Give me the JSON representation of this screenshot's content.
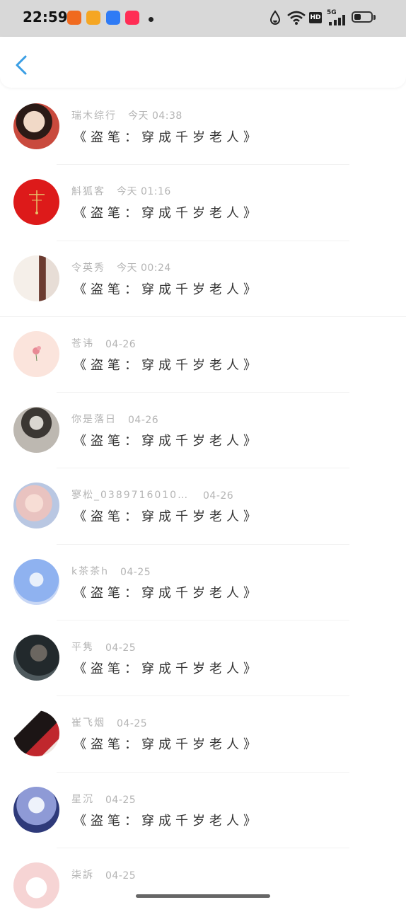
{
  "status_bar": {
    "time": "22:59",
    "hd": "HD",
    "network": "5G"
  },
  "header": {
    "back_icon": "chevron-left-icon"
  },
  "comments": [
    {
      "name": "瑞木综行",
      "time": "今天 04:38",
      "message": "《盗笔：穿成千岁老人》",
      "avatar_color": "#c94a3d"
    },
    {
      "name": "斛狐客",
      "time": "今天 01:16",
      "message": "《盗笔：穿成千岁老人》",
      "avatar_color": "#dd1a1a"
    },
    {
      "name": "令英秀",
      "time": "今天 00:24",
      "message": "《盗笔：穿成千岁老人》",
      "avatar_color": "#c9b7b0"
    },
    {
      "name": "苍讳",
      "time": "04-26",
      "message": "《盗笔：穿成千岁老人》",
      "avatar_color": "#fbe4dc"
    },
    {
      "name": "你是落日",
      "time": "04-26",
      "message": "《盗笔：穿成千岁老人》",
      "avatar_color": "#8a8680"
    },
    {
      "name": "寥松_038971601044​3…",
      "time": "04-26",
      "message": "《盗笔：穿成千岁老人》",
      "avatar_color": "#e9c3c0"
    },
    {
      "name": "k茶茶h",
      "time": "04-25",
      "message": "《盗笔：穿成千岁老人》",
      "avatar_color": "#8fb2f0"
    },
    {
      "name": "平隽",
      "time": "04-25",
      "message": "《盗笔：穿成千岁老人》",
      "avatar_color": "#3d4347"
    },
    {
      "name": "崔飞烟",
      "time": "04-25",
      "message": "《盗笔：穿成千岁老人》",
      "avatar_color": "#2a2323"
    },
    {
      "name": "星沉",
      "time": "04-25",
      "message": "《盗笔：穿成千岁老人》",
      "avatar_color": "#5d6fb8"
    },
    {
      "name": "柒訴",
      "time": "04-25",
      "message": "",
      "avatar_color": "#f6d4d4"
    }
  ]
}
